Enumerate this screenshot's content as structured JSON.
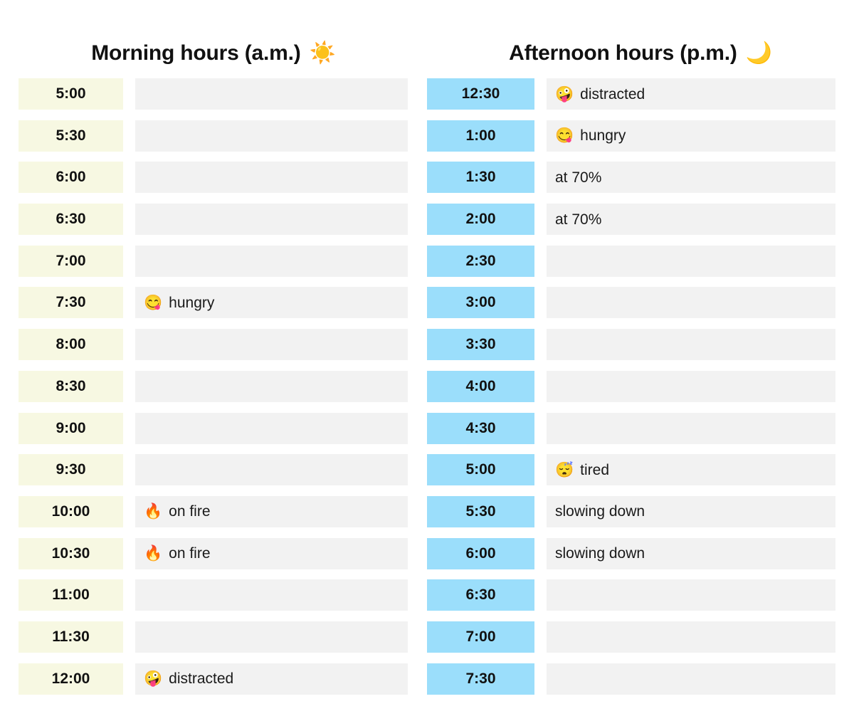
{
  "headers": {
    "left": {
      "title": "Morning hours (a.m.)",
      "emoji": "☀️",
      "icon": "sun-icon"
    },
    "right": {
      "title": "Afternoon hours (p.m.)",
      "emoji": "🌙",
      "icon": "crescent-moon-icon"
    }
  },
  "colors": {
    "morning_time_bg": "#f7f8e2",
    "afternoon_time_bg": "#9bdefb",
    "note_bg": "#f2f2f2",
    "text": "#111111",
    "page_bg": "#ffffff"
  },
  "morning_rows": [
    {
      "time": "5:00",
      "emoji": "",
      "note": ""
    },
    {
      "time": "5:30",
      "emoji": "",
      "note": ""
    },
    {
      "time": "6:00",
      "emoji": "",
      "note": ""
    },
    {
      "time": "6:30",
      "emoji": "",
      "note": ""
    },
    {
      "time": "7:00",
      "emoji": "",
      "note": ""
    },
    {
      "time": "7:30",
      "emoji": "😋",
      "note": "hungry"
    },
    {
      "time": "8:00",
      "emoji": "",
      "note": ""
    },
    {
      "time": "8:30",
      "emoji": "",
      "note": ""
    },
    {
      "time": "9:00",
      "emoji": "",
      "note": ""
    },
    {
      "time": "9:30",
      "emoji": "",
      "note": ""
    },
    {
      "time": "10:00",
      "emoji": "🔥",
      "note": "on fire"
    },
    {
      "time": "10:30",
      "emoji": "🔥",
      "note": "on fire"
    },
    {
      "time": "11:00",
      "emoji": "",
      "note": ""
    },
    {
      "time": "11:30",
      "emoji": "",
      "note": ""
    },
    {
      "time": "12:00",
      "emoji": "🤪",
      "note": "distracted"
    }
  ],
  "afternoon_rows": [
    {
      "time": "12:30",
      "emoji": "🤪",
      "note": "distracted"
    },
    {
      "time": "1:00",
      "emoji": "😋",
      "note": "hungry"
    },
    {
      "time": "1:30",
      "emoji": "",
      "note": "at 70%"
    },
    {
      "time": "2:00",
      "emoji": "",
      "note": "at 70%"
    },
    {
      "time": "2:30",
      "emoji": "",
      "note": ""
    },
    {
      "time": "3:00",
      "emoji": "",
      "note": ""
    },
    {
      "time": "3:30",
      "emoji": "",
      "note": ""
    },
    {
      "time": "4:00",
      "emoji": "",
      "note": ""
    },
    {
      "time": "4:30",
      "emoji": "",
      "note": ""
    },
    {
      "time": "5:00",
      "emoji": "😴",
      "note": "tired"
    },
    {
      "time": "5:30",
      "emoji": "",
      "note": "slowing down"
    },
    {
      "time": "6:00",
      "emoji": "",
      "note": "slowing down"
    },
    {
      "time": "6:30",
      "emoji": "",
      "note": ""
    },
    {
      "time": "7:00",
      "emoji": "",
      "note": ""
    },
    {
      "time": "7:30",
      "emoji": "",
      "note": ""
    }
  ]
}
